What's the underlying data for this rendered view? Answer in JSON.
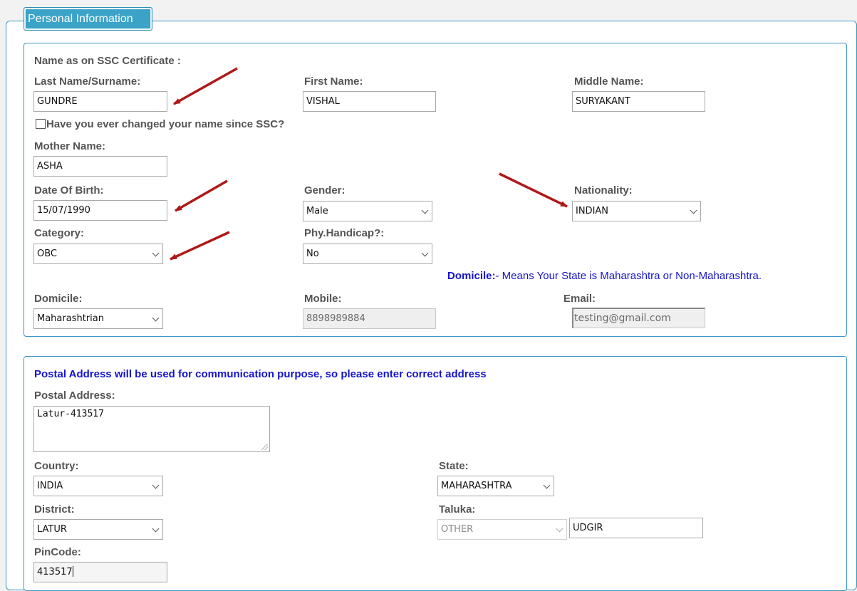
{
  "fieldset_title": "Personal Information",
  "personal": {
    "name_heading": "Name as on SSC Certificate :",
    "last_name": {
      "label": "Last Name/Surname:",
      "value": "GUNDRE"
    },
    "first_name": {
      "label": "First Name:",
      "value": "VISHAL"
    },
    "middle_name": {
      "label": "Middle Name:",
      "value": "SURYAKANT"
    },
    "name_changed": {
      "label": "Have you ever changed your name since SSC?",
      "checked": false
    },
    "mother_name": {
      "label": "Mother Name:",
      "value": "ASHA"
    },
    "dob": {
      "label": "Date Of Birth:",
      "value": "15/07/1990"
    },
    "gender": {
      "label": "Gender:",
      "selected": "Male"
    },
    "nationality": {
      "label": "Nationality:",
      "selected": "INDIAN"
    },
    "category": {
      "label": "Category:",
      "selected": "OBC"
    },
    "phy_handicap": {
      "label": "Phy.Handicap?:",
      "selected": "No"
    },
    "domicile_note": {
      "strong": "Domicile:",
      "text": "- Means Your State is Maharashtra or Non-Maharashtra."
    },
    "domicile": {
      "label": "Domicile:",
      "selected": "Maharashtrian"
    },
    "mobile": {
      "label": "Mobile:",
      "value": "8898989884"
    },
    "email": {
      "label": "Email:",
      "value": "testing@gmail.com"
    }
  },
  "address": {
    "notice": "Postal Address will be used for communication purpose, so please enter correct address",
    "postal_address": {
      "label": "Postal Address:",
      "value": "Latur-413517"
    },
    "country": {
      "label": "Country:",
      "selected": "INDIA"
    },
    "state": {
      "label": "State:",
      "selected": "MAHARASHTRA"
    },
    "district": {
      "label": "District:",
      "selected": "LATUR"
    },
    "taluka": {
      "label": "Taluka:",
      "selected": "OTHER",
      "other_value": "UDGIR"
    },
    "pincode": {
      "label": "PinCode:",
      "value": "413517"
    }
  },
  "colors": {
    "accent": "#3ba3c8",
    "note_blue": "#1515cc",
    "arrow_red": "#b01818"
  }
}
